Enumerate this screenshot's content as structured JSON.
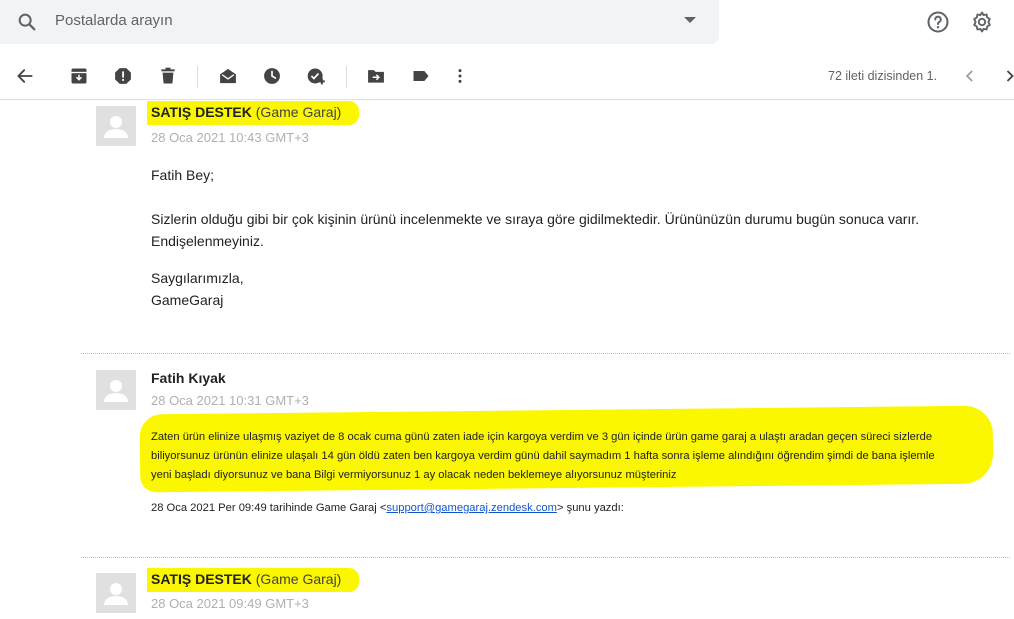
{
  "search": {
    "placeholder": "Postalarda arayın"
  },
  "header_icons": {
    "search": "search-icon",
    "dropdown": "caret-down-icon",
    "help": "help-icon",
    "settings": "gear-icon"
  },
  "toolbar": {
    "icons": [
      "back-arrow-icon",
      "archive-icon",
      "report-spam-icon",
      "delete-icon",
      "mark-unread-icon",
      "snooze-icon",
      "add-task-icon",
      "move-to-icon",
      "label-icon",
      "more-vert-icon"
    ],
    "pager_text": "72 ileti dizisinden 1.",
    "pager_prev": "chevron-left-icon",
    "pager_next": "chevron-right-icon"
  },
  "messages": [
    {
      "sender_name": "SATIŞ DESTEK",
      "sender_org": "(Game Garaj)",
      "date": "28 Oca 2021 10:43 GMT+3",
      "body": [
        "Fatih Bey;",
        "Sizlerin olduğu gibi bir çok kişinin ürünü incelenmekte ve sıraya göre gidilmektedir. Ürününüzün durumu bugün sonuca varır.",
        "Endişelenmeyiniz.",
        "Saygılarımızla,",
        "GameGaraj"
      ]
    },
    {
      "sender_name": "Fatih Kıyak",
      "date": "28 Oca 2021 10:31 GMT+3",
      "body": [
        "Zaten ürün elinize ulaşmış vaziyet de  8 ocak cuma günü zaten iade için kargoya verdim ve 3 gün içinde ürün game garaj a ulaştı aradan geçen süreci sizlerde",
        "biliyorsunuz ürünün elinize ulaşalı 14 gün öldü zaten ben kargoya verdim günü dahil saymadım 1 hafta sonra işleme alındığını öğrendim şimdi de bana işlemle",
        "yeni başladı diyorsunuz ve bana Bilgi vermiyorsunuz 1 ay olacak neden beklemeye alıyorsunuz müşteriniz"
      ],
      "reply_prefix": "28 Oca 2021 Per 09:49 tarihinde Game Garaj <",
      "reply_email": "support@gamegaraj.zendesk.com",
      "reply_suffix": "> şunu yazdı:"
    },
    {
      "sender_name": "SATIŞ DESTEK",
      "sender_org": "(Game Garaj)",
      "date": "28 Oca 2021 09:49 GMT+3"
    }
  ],
  "colors": {
    "highlight": "#fbf700",
    "link": "#1155cc",
    "icon": "#5f6368"
  }
}
